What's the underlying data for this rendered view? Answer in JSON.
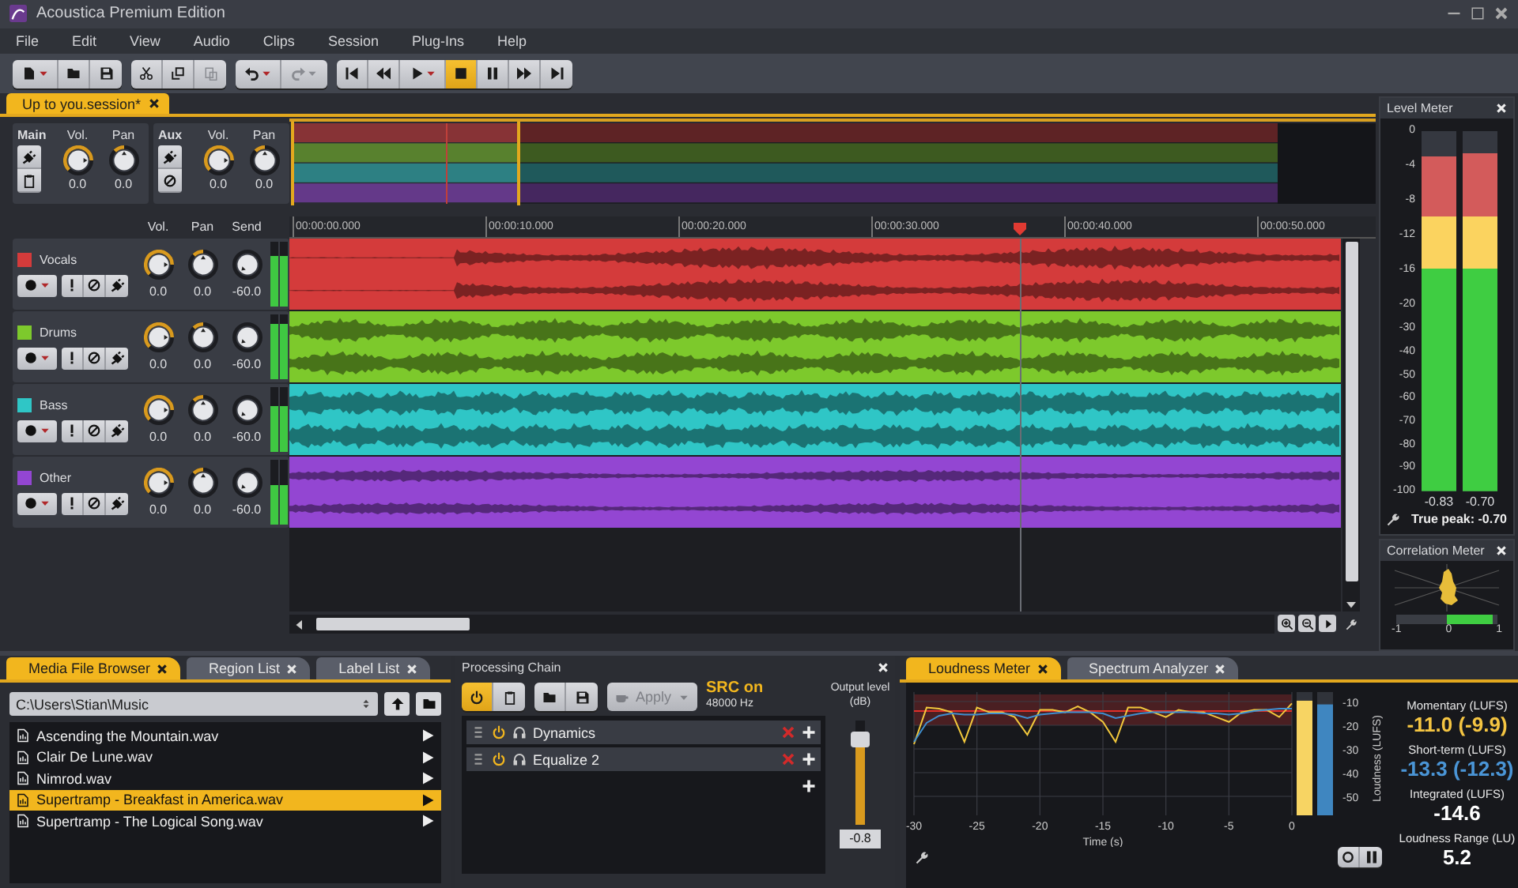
{
  "window": {
    "title": "Acoustica Premium Edition"
  },
  "menu": [
    "File",
    "Edit",
    "View",
    "Audio",
    "Clips",
    "Session",
    "Plug-Ins",
    "Help"
  ],
  "toolbar": [
    [
      {
        "kind": "new",
        "dropdown": true,
        "disabled": false,
        "active": false
      },
      {
        "kind": "open",
        "dropdown": false,
        "disabled": false,
        "active": false
      },
      {
        "kind": "save",
        "dropdown": false,
        "disabled": false,
        "active": false
      }
    ],
    [
      {
        "kind": "cut",
        "dropdown": false,
        "disabled": false,
        "active": false
      },
      {
        "kind": "copy",
        "dropdown": false,
        "disabled": false,
        "active": false
      },
      {
        "kind": "paste",
        "dropdown": false,
        "disabled": true,
        "active": false
      }
    ],
    [
      {
        "kind": "undo",
        "dropdown": true,
        "disabled": false,
        "active": false
      },
      {
        "kind": "redo",
        "dropdown": true,
        "disabled": true,
        "active": false
      }
    ],
    [
      {
        "kind": "start",
        "dropdown": false,
        "disabled": false,
        "active": false
      },
      {
        "kind": "rewind",
        "dropdown": false,
        "disabled": false,
        "active": false
      },
      {
        "kind": "play",
        "dropdown": true,
        "disabled": false,
        "active": false
      },
      {
        "kind": "stop",
        "dropdown": false,
        "disabled": false,
        "active": true
      },
      {
        "kind": "pause",
        "dropdown": false,
        "disabled": false,
        "active": false
      },
      {
        "kind": "forward",
        "dropdown": false,
        "disabled": false,
        "active": false
      },
      {
        "kind": "end",
        "dropdown": false,
        "disabled": false,
        "active": false
      }
    ]
  ],
  "session_tab": {
    "label": "Up to you.session*",
    "selected": true
  },
  "buses": [
    {
      "name": "Main",
      "buttons": [
        {
          "kind": "plug"
        },
        {
          "kind": "clipboard"
        }
      ],
      "controls": [
        {
          "label": "Vol.",
          "value": "0.0"
        },
        {
          "label": "Pan",
          "value": "0.0"
        }
      ]
    },
    {
      "name": "Aux",
      "buttons": [
        {
          "kind": "plug"
        },
        {
          "kind": "nosign"
        }
      ],
      "controls": [
        {
          "label": "Vol.",
          "value": "0.0"
        },
        {
          "label": "Pan",
          "value": "0.0"
        }
      ]
    }
  ],
  "track_columns": [
    "Vol.",
    "Pan",
    "Send"
  ],
  "tracks": [
    {
      "name": "Vocals",
      "color": "#d43b3b",
      "values": [
        "0.0",
        "0.0",
        "-60.0"
      ],
      "meter": {
        "level": 0.78
      }
    },
    {
      "name": "Drums",
      "color": "#7dc92c",
      "values": [
        "0.0",
        "0.0",
        "-60.0"
      ],
      "meter": {
        "level": 0.85
      }
    },
    {
      "name": "Bass",
      "color": "#2fc6c6",
      "values": [
        "0.0",
        "0.0",
        "-60.0"
      ],
      "meter": {
        "level": 0.72
      }
    },
    {
      "name": "Other",
      "color": "#9346d2",
      "values": [
        "0.0",
        "0.0",
        "-60.0"
      ],
      "meter": {
        "level": 0.62
      }
    }
  ],
  "ruler": [
    "00:00:00.000",
    "00:00:10.000",
    "00:00:20.000",
    "00:00:30.000",
    "00:00:40.000",
    "00:00:50.000"
  ],
  "level_meter": {
    "title": "Level Meter",
    "scale": [
      "0",
      "-4",
      "-8",
      "-12",
      "-16",
      "-20",
      "-30",
      "-40",
      "-50",
      "-60",
      "-70",
      "-80",
      "-90",
      "-100"
    ],
    "channels": [
      {
        "level": 0.929,
        "reading": "-0.83"
      },
      {
        "level": 0.938,
        "reading": "-0.70"
      }
    ],
    "true_peak": "True peak: -0.70"
  },
  "correlation_meter": {
    "title": "Correlation Meter",
    "scale": [
      "-1",
      "0",
      "1"
    ],
    "level": 0.45
  },
  "browser": {
    "tabs": [
      {
        "label": "Media File Browser",
        "selected": true
      },
      {
        "label": "Region List",
        "selected": false
      },
      {
        "label": "Label List",
        "selected": false
      }
    ],
    "path": "C:\\Users\\Stian\\Music",
    "files": [
      {
        "name": "Ascending the Mountain.wav",
        "selected": false
      },
      {
        "name": "Clair De Lune.wav",
        "selected": false
      },
      {
        "name": "Nimrod.wav",
        "selected": false
      },
      {
        "name": "Supertramp - Breakfast in America.wav",
        "selected": true
      },
      {
        "name": "Supertramp - The Logical Song.wav",
        "selected": false
      }
    ]
  },
  "chain": {
    "title": "Processing Chain",
    "power_on": true,
    "apply": "Apply",
    "src": "SRC on",
    "rate": "48000 Hz",
    "output_label": "Output level (dB)",
    "plugins": [
      {
        "name": "Dynamics",
        "on": true
      },
      {
        "name": "Equalize 2",
        "on": true
      }
    ],
    "output": {
      "level": 0.82,
      "value": "-0.8"
    }
  },
  "loudness": {
    "tabs": [
      {
        "label": "Loudness Meter",
        "selected": true
      },
      {
        "label": "Spectrum Analyzer",
        "selected": false
      }
    ],
    "chart_data": {
      "type": "line",
      "xlabel": "Time (s)",
      "ylabel": "Loudness (LUFS)",
      "x": [
        -30,
        -29,
        -28,
        -27,
        -26,
        -25,
        -24,
        -23,
        -22,
        -21,
        -20,
        -19,
        -18,
        -17,
        -16,
        -15,
        -14,
        -13,
        -12,
        -11,
        -10,
        -9,
        -8,
        -7,
        -6,
        -5,
        -4,
        -3,
        -2,
        -1,
        0
      ],
      "series": [
        {
          "color": "#f2c83c",
          "values": [
            -28,
            -12.5,
            -13,
            -14.5,
            -27,
            -12.5,
            -14.5,
            -14.5,
            -16.5,
            -24,
            -13.5,
            -13.5,
            -14.5,
            -12,
            -14.5,
            -18.6,
            -27,
            -12.5,
            -12.5,
            -14.5,
            -16.5,
            -13.5,
            -14.5,
            -14.5,
            -16.5,
            -18.6,
            -14.5,
            -13.5,
            -13.5,
            -16.5,
            -10.8
          ]
        },
        {
          "color": "#3f8fd0",
          "values": [
            -27,
            -19,
            -16,
            -15,
            -15.5,
            -15.5,
            -15,
            -15,
            -15.5,
            -17,
            -15.5,
            -15,
            -14.5,
            -14.5,
            -14.5,
            -15,
            -17,
            -16,
            -15,
            -14.5,
            -14.5,
            -14.5,
            -14.5,
            -15,
            -15,
            -15.5,
            -15,
            -14,
            -13.5,
            -13,
            -13
          ]
        }
      ],
      "xlim": [
        -30,
        0
      ],
      "ylim": [
        -58,
        -6
      ],
      "xticks": [
        -30,
        -25,
        -20,
        -15,
        -10,
        -5,
        0
      ],
      "yticks": [
        -10,
        -20,
        -30,
        -40,
        -50
      ],
      "grid": true,
      "bands": [
        {
          "axis": "y",
          "from": -20,
          "to": -7,
          "color": "#4a1f22"
        }
      ],
      "ref_lines": [
        {
          "axis": "y",
          "value": -14,
          "color": "#e0302a"
        }
      ]
    },
    "meters": [
      {
        "level": 0.93,
        "color": "#f7d463"
      },
      {
        "level": 0.9,
        "color": "#3f86c0"
      }
    ],
    "readouts": [
      {
        "label": "Momentary (LUFS)",
        "value": "-11.0 (-9.9)",
        "color": "#f5c542"
      },
      {
        "label": "Short-term (LUFS)",
        "value": "-13.3 (-12.3)",
        "color": "#4a95d6"
      },
      {
        "label": "Integrated (LUFS)",
        "value": "-14.6",
        "color": "#ffffff"
      },
      {
        "label": "Loudness Range (LU)",
        "value": "5.2",
        "color": "#ffffff"
      }
    ]
  }
}
